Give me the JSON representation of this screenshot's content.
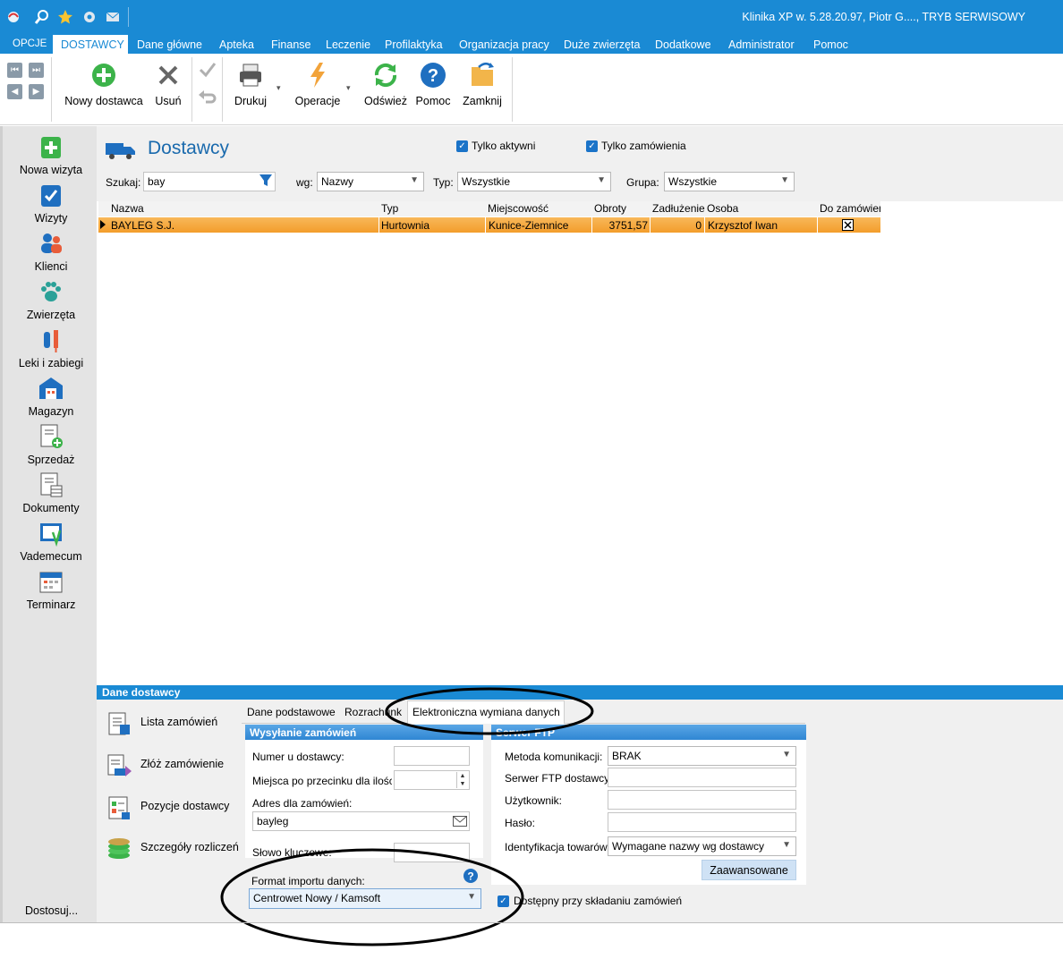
{
  "window": {
    "title": "Klinika XP w. 5.28.20.97, Piotr G...., TRYB SERWISOWY"
  },
  "menu": {
    "items": [
      "OPCJE",
      "Dane główne",
      "Apteka",
      "Finanse",
      "Leczenie",
      "Profilaktyka",
      "Organizacja pracy",
      "Duże zwierzęta",
      "Dodatkowe",
      "Administrator",
      "Pomoc"
    ],
    "active": "DOSTAWCY"
  },
  "ribbon": {
    "new_supplier": "Nowy dostawca",
    "delete": "Usuń",
    "print": "Drukuj",
    "operations": "Operacje",
    "refresh": "Odśwież",
    "help": "Pomoc",
    "close": "Zamknij"
  },
  "leftnav": {
    "items": [
      "Nowa wizyta",
      "Wizyty",
      "Klienci",
      "Zwierzęta",
      "Leki i zabiegi",
      "Magazyn",
      "Sprzedaż",
      "Dokumenty",
      "Vademecum",
      "Terminarz"
    ],
    "customize": "Dostosuj..."
  },
  "page": {
    "title": "Dostawcy",
    "only_active": "Tylko aktywni",
    "only_orders": "Tylko zamówienia"
  },
  "filters": {
    "search_label": "Szukaj:",
    "search_value": "bay",
    "by_label": "wg:",
    "by_value": "Nazwy",
    "type_label": "Typ:",
    "type_value": "Wszystkie",
    "group_label": "Grupa:",
    "group_value": "Wszystkie"
  },
  "grid": {
    "columns": [
      "Nazwa",
      "Typ",
      "Miejscowość",
      "Obroty",
      "Zadłużenie",
      "Osoba",
      "Do zamówień"
    ],
    "rows": [
      {
        "name": "BAYLEG S.J.",
        "type": "Hurtownia",
        "city": "Kunice-Ziemnice",
        "turnover": "3751,57",
        "debt": "0",
        "person": "Krzysztof Iwan",
        "for_orders": true
      }
    ]
  },
  "details": {
    "header": "Dane dostawcy",
    "actions": [
      "Lista zamówień",
      "Złóż zamówienie",
      "Pozycje dostawcy",
      "Szczegóły rozliczeń"
    ],
    "tabs": [
      "Dane podstawowe",
      "Rozrachunki",
      "Elektroniczna wymiana danych"
    ],
    "sending": {
      "header": "Wysyłanie zamówień",
      "supplier_number_label": "Numer u dostawcy:",
      "supplier_number_value": "",
      "decimal_places_label": "Miejsca po przecinku dla ilości",
      "decimal_places_value": "",
      "order_address_label": "Adres dla zamówień:",
      "order_address_value": "bayleg",
      "keyword_label": "Słowo kluczowe:",
      "import_format_label": "Format importu danych:",
      "import_format_value": "Centrowet Nowy / Kamsoft"
    },
    "server": {
      "header": "Serwer FTP",
      "method_label": "Metoda komunikacji:",
      "method_value": "BRAK",
      "ftp_label": "Serwer FTP dostawcy:",
      "user_label": "Użytkownik:",
      "password_label": "Hasło:",
      "ident_label": "Identyfikacja towarów:",
      "ident_value": "Wymagane nazwy wg dostawcy",
      "advanced": "Zaawansowane"
    },
    "available_on_orders": "Dostępny przy składaniu zamówień"
  }
}
